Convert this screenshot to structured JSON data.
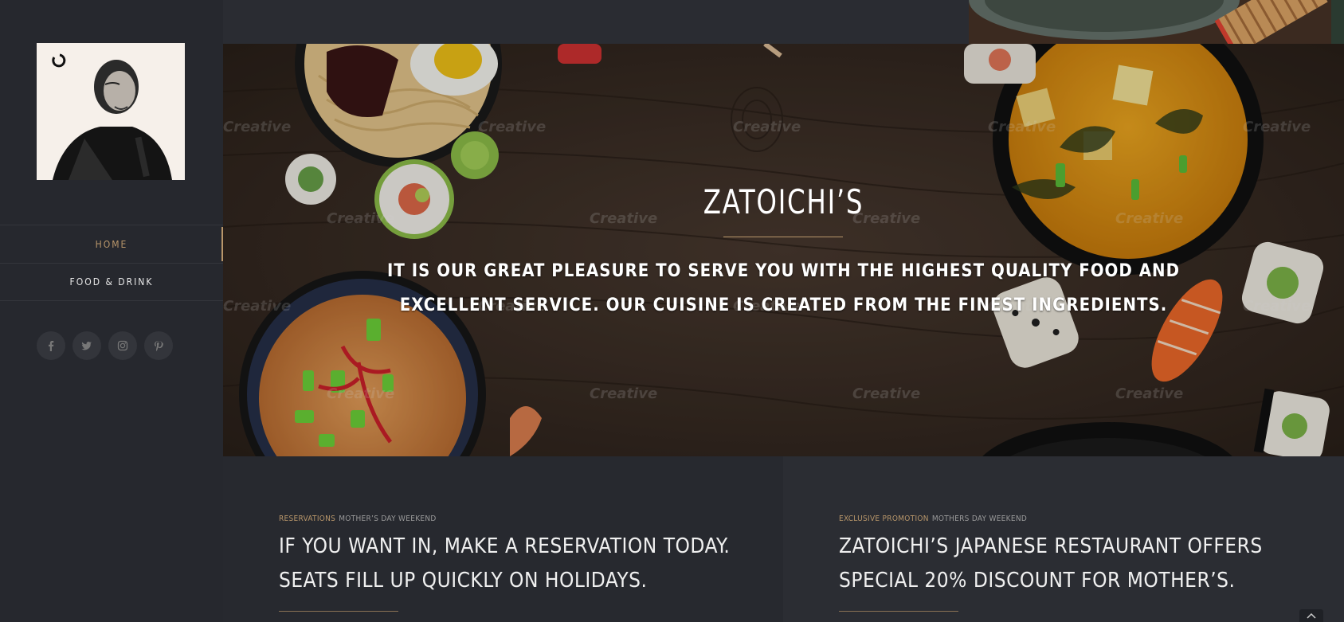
{
  "sidebar": {
    "logo_alt": "Zatoichi portrait",
    "nav": [
      {
        "label": "HOME",
        "active": true
      },
      {
        "label": "FOOD & DRINK",
        "active": false
      }
    ],
    "social": [
      {
        "icon": "facebook-icon"
      },
      {
        "icon": "twitter-icon"
      },
      {
        "icon": "instagram-icon"
      },
      {
        "icon": "pinterest-icon"
      }
    ]
  },
  "hero": {
    "title": "ZATOICHI’S",
    "subtitle": "IT IS OUR GREAT PLEASURE TO SERVE YOU WITH THE HIGHEST QUALITY FOOD AND EXCELLENT SERVICE. OUR CUISINE IS CREATED FROM THE FINEST INGREDIENTS.",
    "watermark": "Creative"
  },
  "posts": [
    {
      "category": "RESERVATIONS",
      "tag": "MOTHER’S DAY WEEKEND",
      "title": "IF YOU WANT IN, MAKE A RESERVATION TODAY. SEATS FILL UP QUICKLY ON HOLIDAYS."
    },
    {
      "category": "EXCLUSIVE PROMOTION",
      "tag": "MOTHERS DAY WEEKEND",
      "title": "ZATOICHI’S JAPANESE RESTAURANT OFFERS SPECIAL 20% DISCOUNT FOR MOTHER’S."
    }
  ],
  "colors": {
    "accent": "#b8966a",
    "sidebar_bg": "#26282e",
    "panel_bg": "#27292f"
  }
}
